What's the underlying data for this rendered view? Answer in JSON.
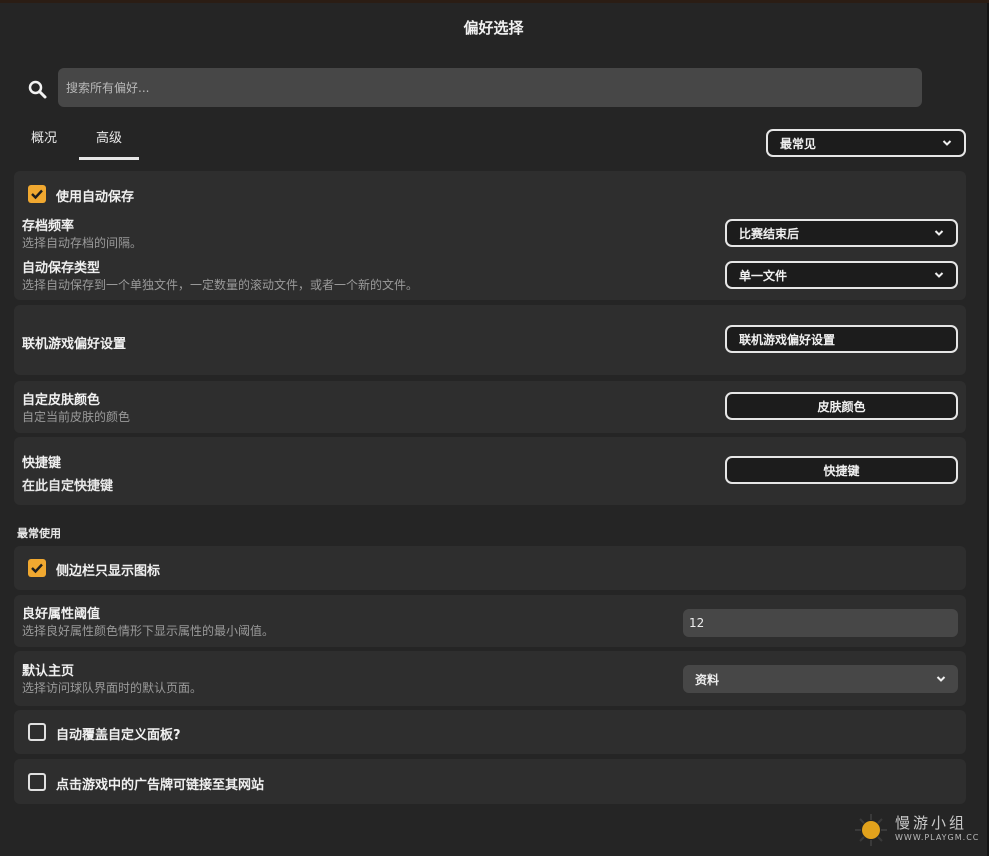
{
  "window": {
    "title": "偏好选择"
  },
  "search": {
    "placeholder": "搜索所有偏好..."
  },
  "tabs": [
    {
      "label": "概况",
      "active": false
    },
    {
      "label": "高级",
      "active": true
    }
  ],
  "view_select": {
    "value": "最常见"
  },
  "autosave": {
    "enable_label": "使用自动保存",
    "enable_checked": true,
    "frequency": {
      "title": "存档频率",
      "desc": "选择自动存档的间隔。",
      "value": "比赛结束后"
    },
    "type": {
      "title": "自动保存类型",
      "desc": "选择自动保存到一个单独文件，一定数量的滚动文件，或者一个新的文件。",
      "value": "单一文件"
    }
  },
  "online": {
    "title": "联机游戏偏好设置",
    "button": "联机游戏偏好设置"
  },
  "skin": {
    "title": "自定皮肤颜色",
    "desc": "自定当前皮肤的颜色",
    "button": "皮肤颜色"
  },
  "shortcuts": {
    "title": "快捷键",
    "desc": "在此自定快捷键",
    "button": "快捷键"
  },
  "common": {
    "heading": "最常使用",
    "sidebar_icons": {
      "label": "侧边栏只显示图标",
      "checked": true
    },
    "attr_threshold": {
      "title": "良好属性阈值",
      "desc": "选择良好属性颜色情形下显示属性的最小阈值。",
      "value": "12"
    },
    "default_home": {
      "title": "默认主页",
      "desc": "选择访问球队界面时的默认页面。",
      "value": "资料"
    },
    "auto_overwrite": {
      "label": "自动覆盖自定义面板?",
      "checked": false
    },
    "billboard_link": {
      "label": "点击游戏中的广告牌可链接至其网站",
      "checked": false
    }
  },
  "watermark": {
    "text": "慢游小组",
    "url": "WWW.PLAYGM.CC"
  },
  "colors": {
    "accent": "#f0a830",
    "panel": "#2e2e2e",
    "background": "#252525"
  }
}
